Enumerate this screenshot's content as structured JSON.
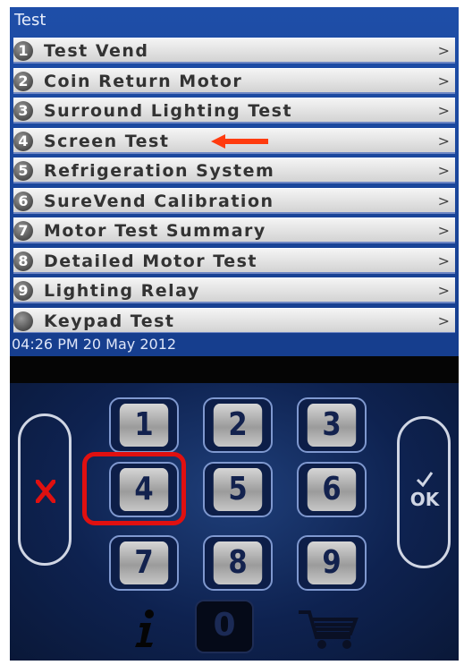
{
  "screen": {
    "title": "Test",
    "menu_items": [
      {
        "number": "1",
        "label": "Test Vend",
        "chevron": ">"
      },
      {
        "number": "2",
        "label": "Coin Return Motor",
        "chevron": ">"
      },
      {
        "number": "3",
        "label": "Surround Lighting Test",
        "chevron": ">"
      },
      {
        "number": "4",
        "label": "Screen Test",
        "chevron": ">"
      },
      {
        "number": "5",
        "label": "Refrigeration System",
        "chevron": ">"
      },
      {
        "number": "6",
        "label": "SureVend Calibration",
        "chevron": ">"
      },
      {
        "number": "7",
        "label": "Motor Test Summary",
        "chevron": ">"
      },
      {
        "number": "8",
        "label": "Detailed Motor Test",
        "chevron": ">"
      },
      {
        "number": "9",
        "label": "Lighting Relay",
        "chevron": ">"
      },
      {
        "number": "",
        "label": "Keypad Test",
        "chevron": ">"
      }
    ],
    "status": "04:26 PM 20 May 2012"
  },
  "keypad": {
    "keys": [
      "1",
      "2",
      "3",
      "4",
      "5",
      "6",
      "7",
      "8",
      "9"
    ],
    "zero": "0",
    "cancel_icon": "x-icon",
    "ok_label": "OK",
    "ok_icon": "checkmark-icon",
    "info_icon": "info-icon",
    "cart_icon": "cart-icon"
  },
  "colors": {
    "screen_blue": "#1e4ea8",
    "highlight_red": "#e01010",
    "arrow_red": "#ff3b0f",
    "keypad_bg": "#0e2250"
  }
}
